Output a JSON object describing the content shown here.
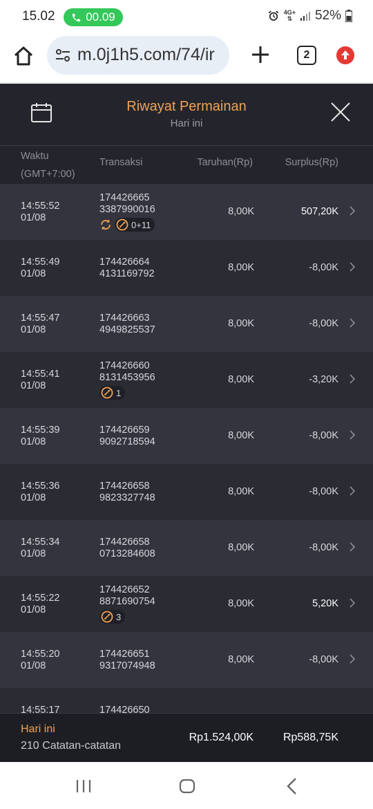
{
  "status": {
    "time": "15.02",
    "call_timer": "00.09",
    "network": "4G+",
    "battery": "52%"
  },
  "browser": {
    "url": "m.0j1h5.com/74/ir",
    "tab_count": "2"
  },
  "header": {
    "title": "Riwayat Permainan",
    "subtitle": "Hari ini"
  },
  "columns": {
    "time_line1": "Waktu",
    "time_line2": "(GMT+7:00)",
    "transaction": "Transaksi",
    "bet": "Taruhan(Rp)",
    "surplus": "Surplus(Rp)"
  },
  "rows": [
    {
      "time": "14:55:52",
      "date": "01/08",
      "tx1": "174426665",
      "tx2": "3387990016",
      "bet": "8,00K",
      "surplus": "507,20K",
      "spin": true,
      "badge": "0+11"
    },
    {
      "time": "14:55:49",
      "date": "01/08",
      "tx1": "174426664",
      "tx2": "4131169792",
      "bet": "8,00K",
      "surplus": "-8,00K"
    },
    {
      "time": "14:55:47",
      "date": "01/08",
      "tx1": "174426663",
      "tx2": "4949825537",
      "bet": "8,00K",
      "surplus": "-8,00K"
    },
    {
      "time": "14:55:41",
      "date": "01/08",
      "tx1": "174426660",
      "tx2": "8131453956",
      "bet": "8,00K",
      "surplus": "-3,20K",
      "badge": "1"
    },
    {
      "time": "14:55:39",
      "date": "01/08",
      "tx1": "174426659",
      "tx2": "9092718594",
      "bet": "8,00K",
      "surplus": "-8,00K"
    },
    {
      "time": "14:55:36",
      "date": "01/08",
      "tx1": "174426658",
      "tx2": "9823327748",
      "bet": "8,00K",
      "surplus": "-8,00K"
    },
    {
      "time": "14:55:34",
      "date": "01/08",
      "tx1": "174426658",
      "tx2": "0713284608",
      "bet": "8,00K",
      "surplus": "-8,00K"
    },
    {
      "time": "14:55:22",
      "date": "01/08",
      "tx1": "174426652",
      "tx2": "8871690754",
      "bet": "8,00K",
      "surplus": "5,20K",
      "badge": "3"
    },
    {
      "time": "14:55:20",
      "date": "01/08",
      "tx1": "174426651",
      "tx2": "9317074948",
      "bet": "8,00K",
      "surplus": "-8,00K"
    },
    {
      "time": "14:55:17",
      "date": "",
      "tx1": "174426650",
      "tx2": "",
      "bet": "",
      "surplus": ""
    }
  ],
  "footer": {
    "label": "Hari ini",
    "count": "210 Catatan-catatan",
    "total_bet": "Rp1.524,00K",
    "total_surplus": "Rp588,75K"
  },
  "colors": {
    "accent": "#f0a255",
    "background": "#2a2b33",
    "row_alt": "#33343d"
  }
}
